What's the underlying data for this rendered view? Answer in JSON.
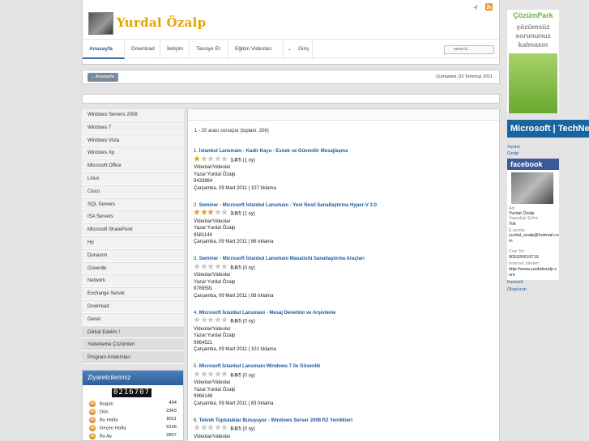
{
  "header": {
    "title": "Yurdal Özalp",
    "icons": [
      "twitter-bird-icon",
      "rss-icon"
    ]
  },
  "nav": [
    {
      "label": "Anasayfa",
      "active": true
    },
    {
      "label": "Download"
    },
    {
      "label": "İletişim"
    },
    {
      "label": "Tavsiye Et"
    },
    {
      "label": "Eğitim Videoları"
    },
    {
      "label": "Giriş"
    }
  ],
  "search": {
    "placeholder": "search..."
  },
  "breadcrumb": {
    "label": "Anasayfa"
  },
  "date": "Cumartesi, 02 Temmuz 2011",
  "sidebar": [
    "Windows Servers 2008",
    "Windows 7",
    "Windows Vista",
    "Windows Xp",
    "Microsoft Office",
    "Linux",
    "Cisco",
    "SQL Servers",
    "ISA Servers",
    "Microsoft SharePoint",
    "Hp",
    "Donanım",
    "Güvenlik",
    "Network",
    "Exchange Server",
    "Download",
    "Genel",
    "Dikkat Edelim !",
    "Yedekleme Çözümleri",
    "Program Anlatımları"
  ],
  "visitors": {
    "title": "Ziyaretcilerimiz",
    "counter": "0216707",
    "rows": [
      {
        "label": "Bugün",
        "value": "494"
      },
      {
        "label": "Dün",
        "value": "2343"
      },
      {
        "label": "Bu Hafta",
        "value": "8011"
      },
      {
        "label": "Geçen Hafta",
        "value": "9136"
      },
      {
        "label": "Bu Ay",
        "value": "2837"
      }
    ]
  },
  "results": {
    "summary": "1 - 20 arası sonuçlar (toplam: 206)",
    "entries": [
      {
        "num": "1.",
        "title": "İstanbul Lansmanı - Kadir Kaya - Esnek ve Güvenilir Mesajlaşma",
        "rating": "1.0",
        "of": "/5 (1 oy)",
        "stars": 1,
        "category": "Videolar/Videolar",
        "author": "Yazar:Yurdal Özalp",
        "id": "9433864",
        "meta": "Çarşamba, 09 Mart 2011 | 107 tıklama"
      },
      {
        "num": "2.",
        "title": "Seminer - Microsoft İstanbul Lansmanı - Yeni Nesil Sanallaştırma Hyper-V 2.0",
        "rating": "3.0",
        "of": "/5 (1 oy)",
        "stars": 3,
        "category": "Videolar/Videolar",
        "author": "Yazar:Yurdal Özalp",
        "id": "9581144",
        "meta": "Çarşamba, 09 Mart 2011 | 86 tıklama"
      },
      {
        "num": "3.",
        "title": "Seminer - Microsoft İstanbul Lansmanı Masaüstü Sanallaştırma Araçları",
        "rating": "0.0",
        "of": "/5 (0 oy)",
        "stars": 0,
        "category": "Videolar/Videolar",
        "author": "Yazar:Yurdal Özalp",
        "id": "9789591",
        "meta": "Çarşamba, 09 Mart 2011 | 88 tıklama"
      },
      {
        "num": "4.",
        "title": "Microsoft İstanbul Lansmanı - Mesaj Denetimi ve Arşivleme",
        "rating": "0.0",
        "of": "/5 (0 oy)",
        "stars": 0,
        "category": "Videolar/Videolar",
        "author": "Yazar:Yurdal Özalp",
        "id": "9964521",
        "meta": "Çarşamba, 09 Mart 2011 | 101 tıklama"
      },
      {
        "num": "5.",
        "title": "Microsoft İstanbul Lansmanı Windows 7 ile Güvenlik",
        "rating": "0.0",
        "of": "/5 (0 oy)",
        "stars": 0,
        "category": "Videolar/Videolar",
        "author": "Yazar:Yurdal Özalp",
        "id": "9966146",
        "meta": "Çarşamba, 09 Mart 2011 | 83 tıklama"
      },
      {
        "num": "6.",
        "title": "Teknik Topluluklar Buluşuyor - Windows Server 2008 R2 Yenilikleri",
        "rating": "0.0",
        "of": "/5 (0 oy)",
        "stars": 0,
        "category": "Videolar/Videolar",
        "author": "",
        "id": "",
        "meta": ""
      }
    ]
  },
  "right": {
    "ad_brand": "ÇözümPark",
    "ad_lines": [
      "çözümsüz",
      "sorununuz",
      "kalmasın"
    ],
    "ms_banner": "Microsoft | TechNet",
    "links_top": [
      "Yurdal",
      "Özalp"
    ],
    "facebook": {
      "title": "facebook",
      "fields": [
        {
          "label": "Ad:",
          "value": "Yurdal Özalp"
        },
        {
          "label": "Yaşadığı Şehir:",
          "value": "Yok"
        },
        {
          "label": "E-posta:",
          "value": "yurdal_ozalp@hotmail.com"
        },
        {
          "label": "Cep Tel:",
          "value": "905326610719"
        },
        {
          "label": "İnternet Siteleri:",
          "value": "http://www.yurdalozalp.com"
        }
      ],
      "links": [
        "Kartvizit",
        "Oluşturun"
      ]
    }
  },
  "colors": {
    "link": "#1b5aa0",
    "accent": "#e3a400",
    "facebook": "#3b5998"
  }
}
